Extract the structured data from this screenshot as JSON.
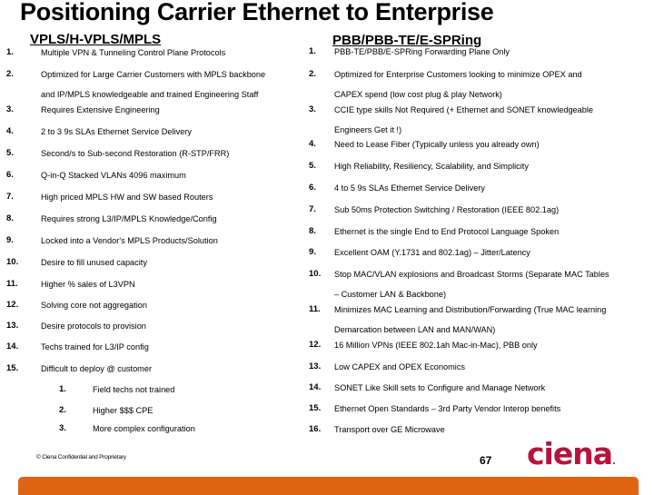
{
  "slide": {
    "title": "Positioning Carrier Ethernet to Enterprise",
    "page_number": "67",
    "footer_text": "© Ciena Confidential and Proprietary",
    "logo_text": "ciena",
    "logo_dot": ".",
    "colors": {
      "logo": "#b5123d",
      "footer_bar": "#de6414"
    }
  },
  "left": {
    "heading": "VPLS/H-VPLS/MPLS",
    "items": [
      {
        "num": "1.",
        "lines": [
          "Multiple VPN & Tunneling Control Plane Protocols"
        ]
      },
      {
        "num": "2.",
        "lines": [
          "Optimized for Large Carrier Customers with MPLS backbone",
          "and IP/MPLS knowledgeable and trained Engineering Staff"
        ]
      },
      {
        "num": "3.",
        "lines": [
          "Requires Extensive Engineering"
        ]
      },
      {
        "num": "4.",
        "lines": [
          "2 to 3 9s SLAs Ethernet Service Delivery"
        ]
      },
      {
        "num": "5.",
        "lines": [
          "Second/s to Sub-second Restoration (R-STP/FRR)"
        ]
      },
      {
        "num": "6.",
        "lines": [
          "Q-in-Q Stacked VLANs 4096 maximum"
        ]
      },
      {
        "num": "7.",
        "lines": [
          "High priced MPLS HW and SW based Routers"
        ]
      },
      {
        "num": "8.",
        "lines": [
          "Requires strong L3/IP/MPLS Knowledge/Config"
        ]
      },
      {
        "num": "9.",
        "lines": [
          "Locked into a Vendor's MPLS Products/Solution"
        ]
      },
      {
        "num": "10.",
        "lines": [
          "Desire to fill unused capacity"
        ]
      },
      {
        "num": "11.",
        "lines": [
          "Higher % sales of L3VPN"
        ]
      },
      {
        "num": "12.",
        "lines": [
          "Solving core not aggregation"
        ]
      },
      {
        "num": "13.",
        "lines": [
          "Desire protocols to provision"
        ]
      },
      {
        "num": "14.",
        "lines": [
          "Techs trained for L3/IP config"
        ]
      },
      {
        "num": "15.",
        "lines": [
          "Difficult to deploy @ customer"
        ]
      }
    ],
    "sub_items": [
      {
        "num": "1.",
        "text": "Field techs not trained"
      },
      {
        "num": "2.",
        "text": "Higher $$$ CPE"
      },
      {
        "num": "3.",
        "text": "More complex configuration"
      }
    ]
  },
  "right": {
    "heading": "PBB/PBB-TE/E-SPRing",
    "items": [
      {
        "num": "1.",
        "lines": [
          "PBB-TE/PBB/E-SPRing Forwarding Plane Only"
        ]
      },
      {
        "num": "2.",
        "lines": [
          "Optimized for Enterprise Customers looking to minimize OPEX and",
          "CAPEX spend (low cost plug & play Network)"
        ]
      },
      {
        "num": "3.",
        "lines": [
          "CCIE type skills Not Required (+ Ethernet and SONET knowledgeable",
          "Engineers Get it !)"
        ]
      },
      {
        "num": "4.",
        "lines": [
          "Need to Lease Fiber (Typically unless you already own)"
        ]
      },
      {
        "num": "5.",
        "lines": [
          "High Reliability, Resiliency, Scalability, and Simplicity"
        ]
      },
      {
        "num": "6.",
        "lines": [
          "4 to 5 9s SLAs Ethernet Service Delivery"
        ]
      },
      {
        "num": "7.",
        "lines": [
          "Sub 50ms Protection Switching / Restoration (IEEE 802.1ag)"
        ]
      },
      {
        "num": "8.",
        "lines": [
          "Ethernet is the single End to End Protocol Language Spoken"
        ]
      },
      {
        "num": "9.",
        "lines": [
          "Excellent OAM (Y.1731 and 802.1ag) – Jitter/Latency"
        ]
      },
      {
        "num": "10.",
        "lines": [
          "Stop MAC/VLAN explosions and Broadcast Storms (Separate MAC Tables",
          "– Customer LAN & Backbone)"
        ]
      },
      {
        "num": "11.",
        "lines": [
          "Minimizes MAC Learning and Distribution/Forwarding (True MAC learning",
          "Demarcation between LAN and MAN/WAN)"
        ]
      },
      {
        "num": "12.",
        "lines": [
          "16 Million VPNs (IEEE 802.1ah Mac-in-Mac), PBB only"
        ]
      },
      {
        "num": "13.",
        "lines": [
          "Low CAPEX and OPEX Economics"
        ]
      },
      {
        "num": "14.",
        "lines": [
          "SONET Like Skill sets to Configure and Manage Network"
        ]
      },
      {
        "num": "15.",
        "lines": [
          "Ethernet Open Standards – 3rd Party Vendor Interop benefits"
        ]
      },
      {
        "num": "16.",
        "lines": [
          "Transport over GE Microwave"
        ]
      }
    ]
  }
}
